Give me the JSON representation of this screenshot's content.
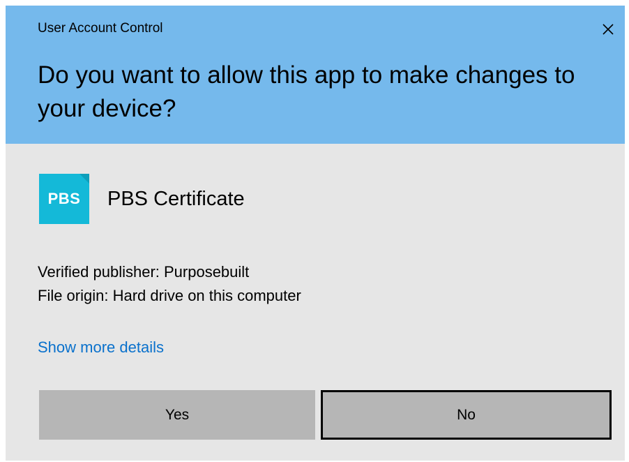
{
  "window": {
    "title": "User Account Control",
    "close_icon": "close-icon"
  },
  "prompt": {
    "question": "Do you want to allow this app to make changes to your device?"
  },
  "app": {
    "logo_text": "PBS",
    "logo_color": "#14b9d8",
    "name": "PBS Certificate"
  },
  "details": {
    "publisher": "Verified publisher: Purposebuilt",
    "origin": "File origin: Hard drive on this computer",
    "show_more": "Show more details"
  },
  "buttons": {
    "yes": "Yes",
    "no": "No"
  },
  "colors": {
    "header": "#75b9ec",
    "body": "#e6e6e6",
    "link": "#0a71cc",
    "button": "#b6b6b6"
  }
}
